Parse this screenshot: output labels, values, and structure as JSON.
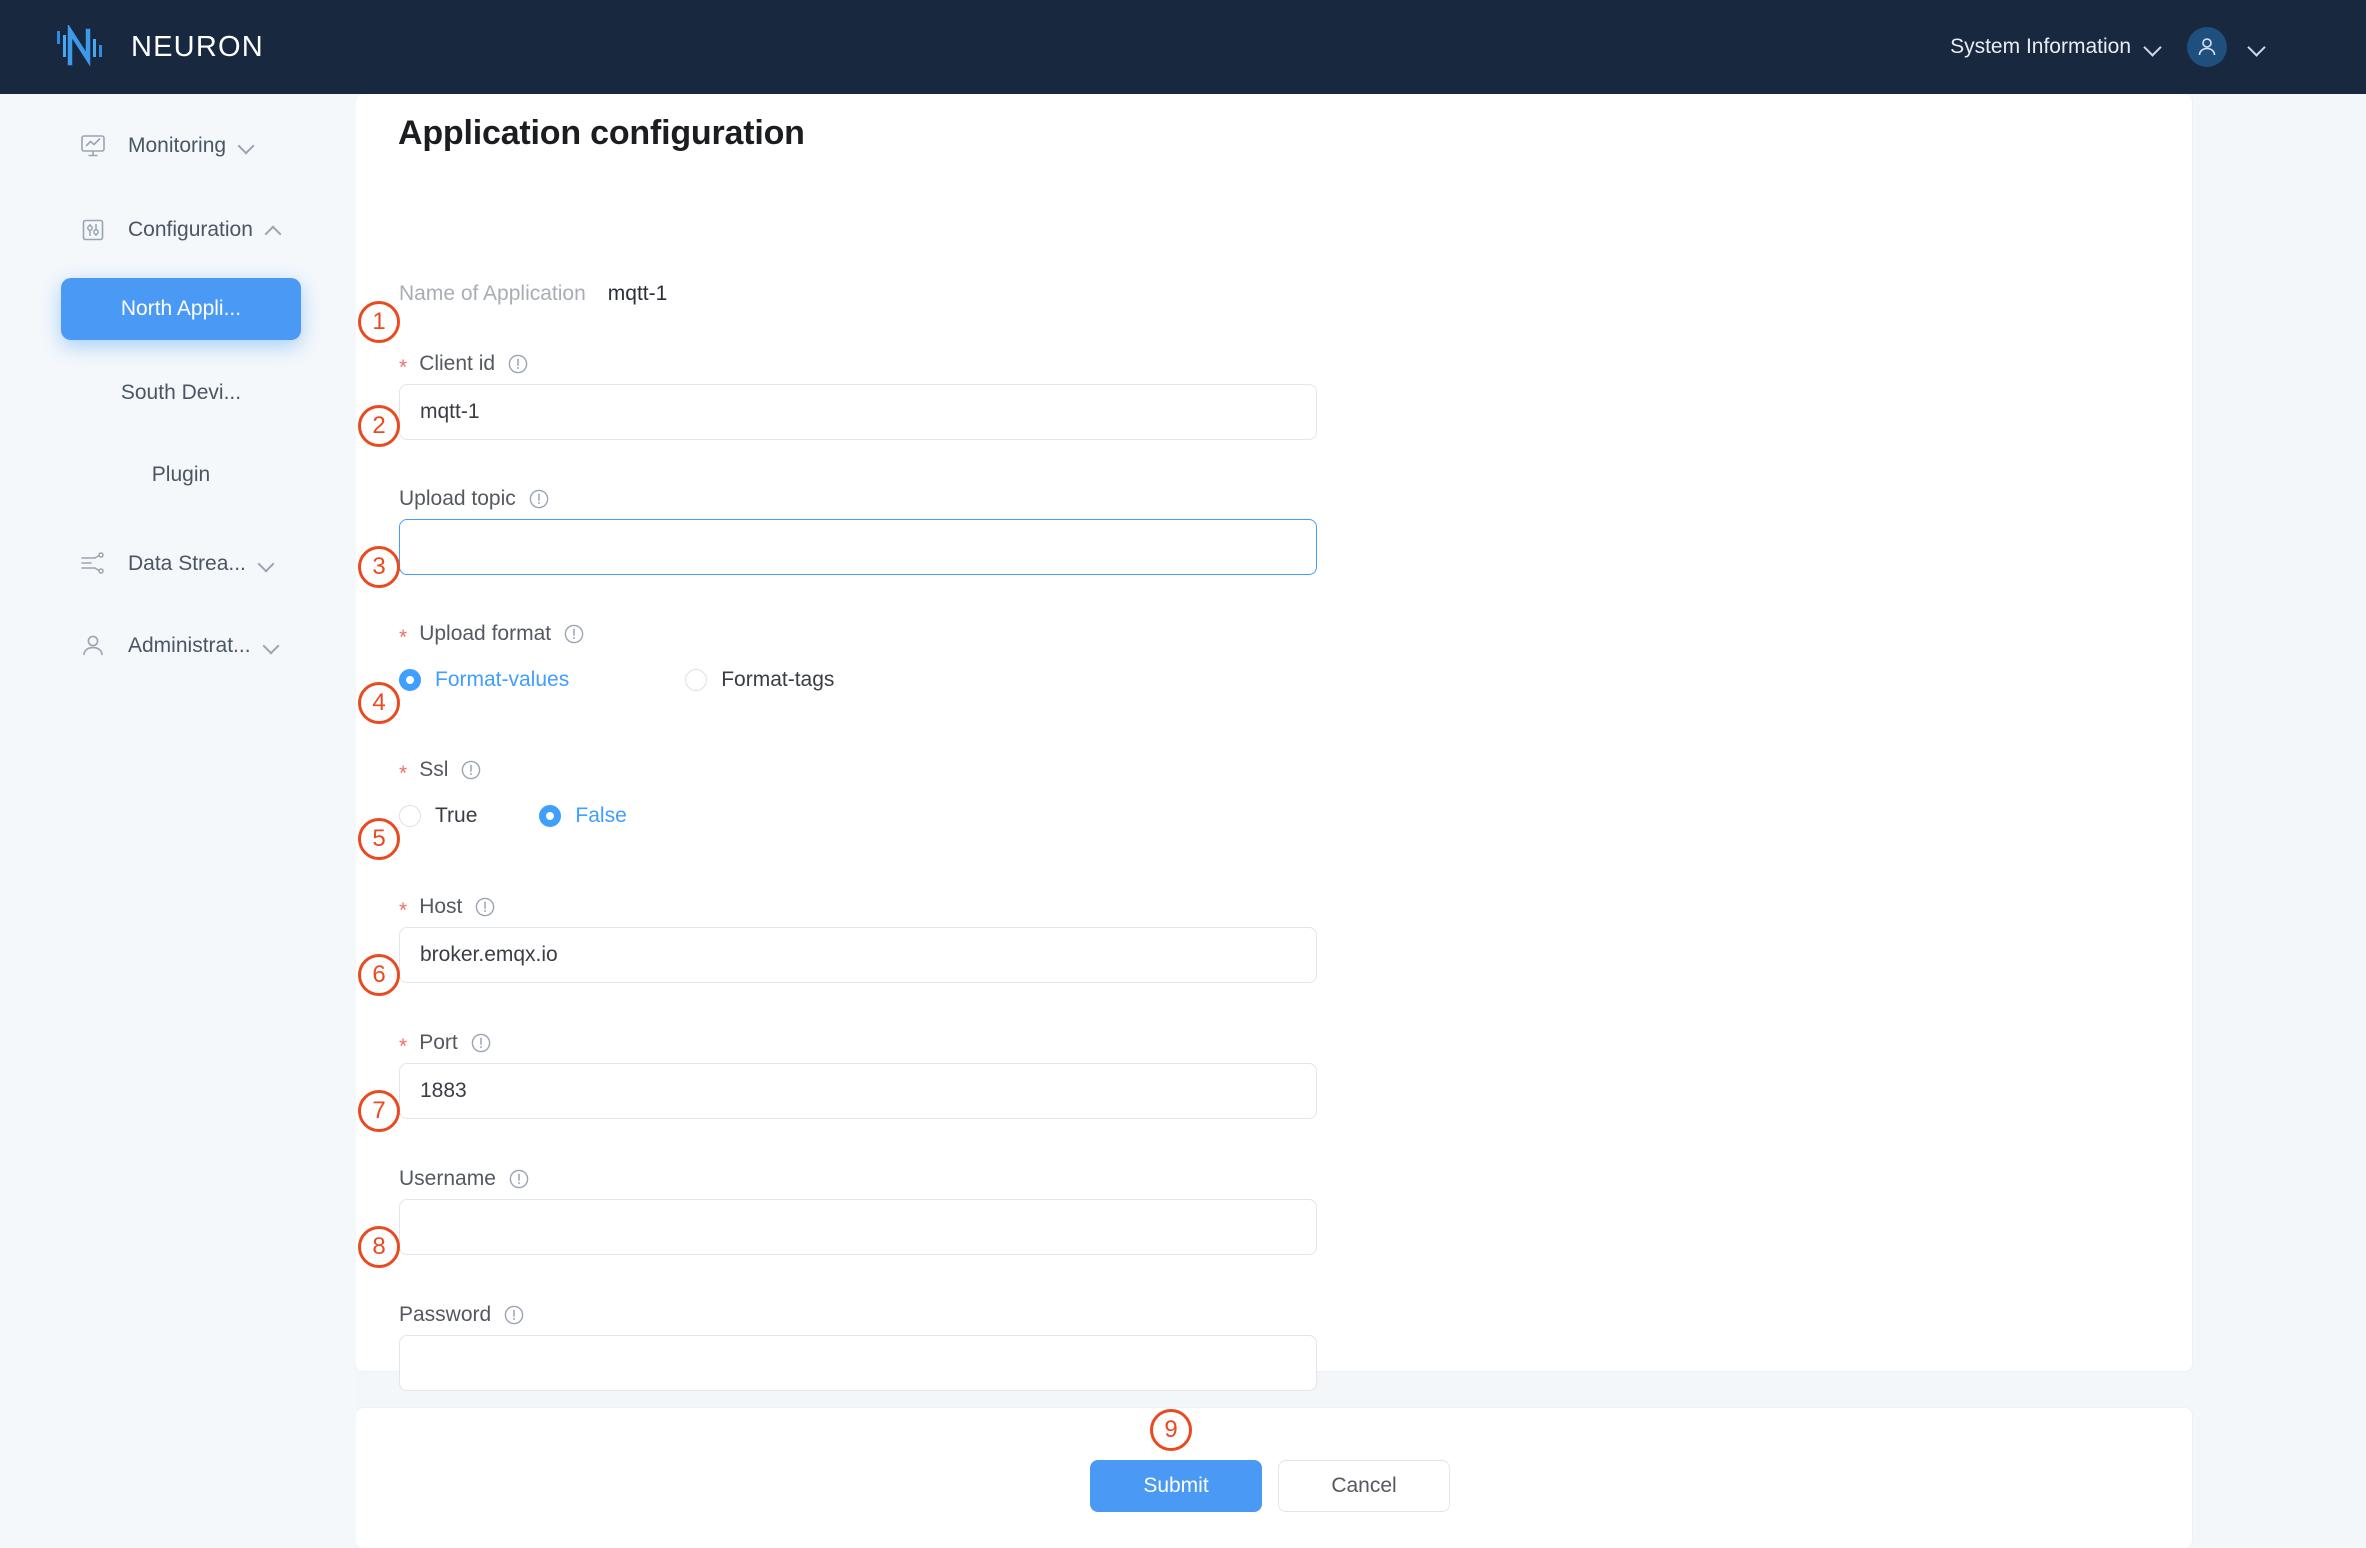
{
  "header": {
    "brand_name": "NEURON",
    "brand_icon": "neuron-logo-icon",
    "system_information_label": "System Information",
    "system_information_caret": "chevron-down-icon",
    "avatar_icon": "user-avatar-icon",
    "avatar_caret": "chevron-down-icon"
  },
  "sidebar": {
    "items": [
      {
        "label": "Monitoring",
        "icon": "monitor-chart-icon",
        "caret": "chevron-down-icon",
        "expanded": false
      },
      {
        "label": "Configuration",
        "icon": "sliders-icon",
        "caret": "chevron-up-icon",
        "expanded": true
      },
      {
        "label": "Data Strea...",
        "icon": "data-stream-icon",
        "caret": "chevron-down-icon",
        "expanded": false
      },
      {
        "label": "Administrat...",
        "icon": "user-icon",
        "caret": "chevron-down-icon",
        "expanded": false
      }
    ],
    "sub_items": [
      {
        "label": "North Appli...",
        "active": true
      },
      {
        "label": "South Devi...",
        "active": false
      },
      {
        "label": "Plugin",
        "active": false
      }
    ]
  },
  "main": {
    "page_title": "Application configuration",
    "app_name_label": "Name of Application",
    "app_name_value": "mqtt-1",
    "info_icon": "info-circle-icon",
    "fields": [
      {
        "key": "client_id",
        "label": "Client id",
        "required": true,
        "type": "text",
        "value": "mqtt-1",
        "placeholder": "",
        "focused": false
      },
      {
        "key": "upload_topic",
        "label": "Upload topic",
        "required": false,
        "type": "text",
        "value": "",
        "placeholder": "",
        "focused": true
      },
      {
        "key": "upload_format",
        "label": "Upload format",
        "required": true,
        "type": "radio",
        "options": [
          {
            "label": "Format-values",
            "selected": true
          },
          {
            "label": "Format-tags",
            "selected": false
          }
        ]
      },
      {
        "key": "ssl",
        "label": "Ssl",
        "required": true,
        "type": "radio",
        "options": [
          {
            "label": "True",
            "selected": false
          },
          {
            "label": "False",
            "selected": true
          }
        ]
      },
      {
        "key": "host",
        "label": "Host",
        "required": true,
        "type": "text",
        "value": "broker.emqx.io",
        "placeholder": "",
        "focused": false
      },
      {
        "key": "port",
        "label": "Port",
        "required": true,
        "type": "text",
        "value": "1883",
        "placeholder": "",
        "focused": false
      },
      {
        "key": "username",
        "label": "Username",
        "required": false,
        "type": "text",
        "value": "",
        "placeholder": "",
        "focused": false
      },
      {
        "key": "password",
        "label": "Password",
        "required": false,
        "type": "text",
        "value": "",
        "placeholder": "",
        "focused": false
      }
    ],
    "required_marker": "*",
    "submit_label": "Submit",
    "cancel_label": "Cancel"
  },
  "annotations": [
    {
      "number": "1",
      "target": "client-id-input"
    },
    {
      "number": "2",
      "target": "upload-topic-input"
    },
    {
      "number": "3",
      "target": "upload-format-radio-group"
    },
    {
      "number": "4",
      "target": "ssl-radio-group"
    },
    {
      "number": "5",
      "target": "host-input"
    },
    {
      "number": "6",
      "target": "port-input"
    },
    {
      "number": "7",
      "target": "username-input"
    },
    {
      "number": "8",
      "target": "password-input"
    },
    {
      "number": "9",
      "target": "submit-button"
    }
  ],
  "colors": {
    "topbar_bg": "#17283f",
    "accent_blue": "#4a9af5",
    "radio_blue": "#409eff",
    "annotation_red": "#ea4a1f",
    "required_red": "#f56c6c",
    "page_bg": "#f4f7fa"
  }
}
